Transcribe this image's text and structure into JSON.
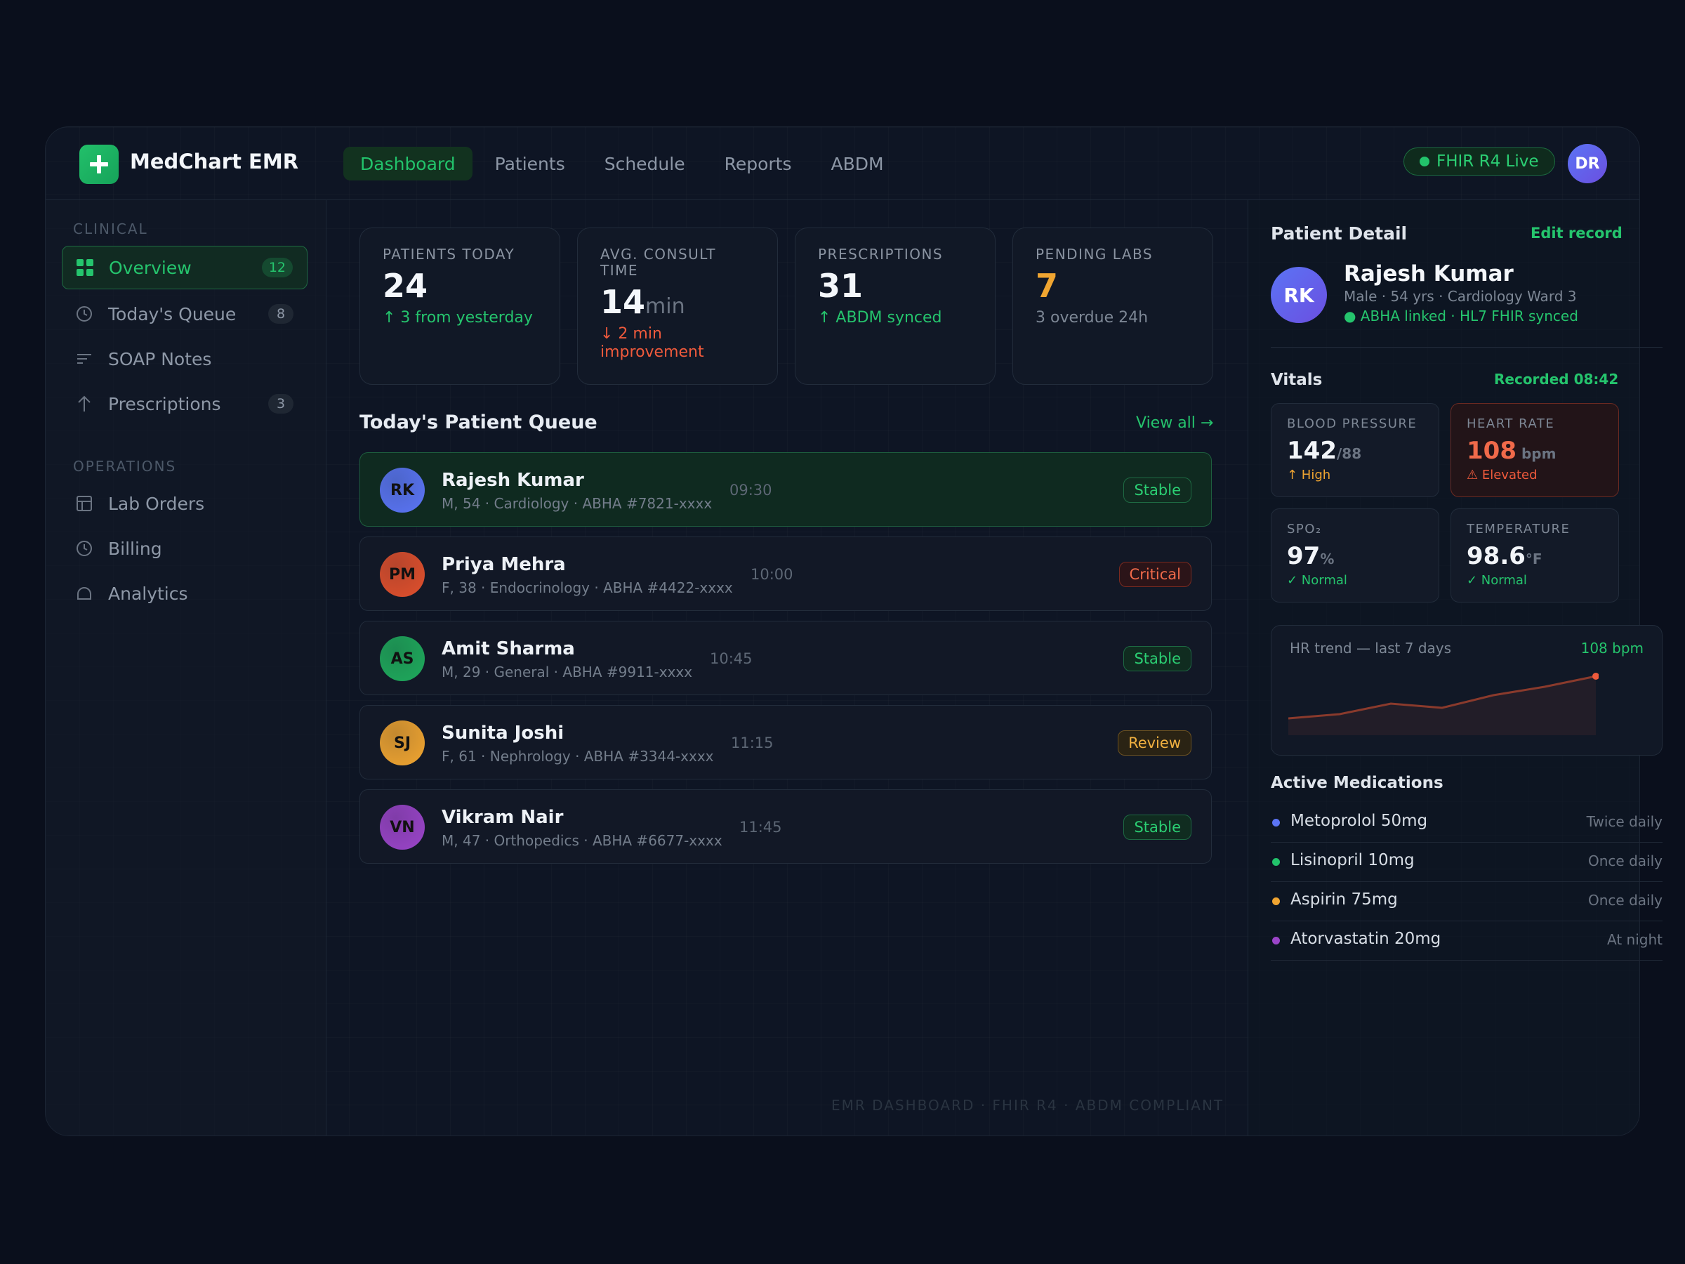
{
  "app": {
    "title": "MedChart EMR"
  },
  "nav": {
    "items": [
      "Dashboard",
      "Patients",
      "Schedule",
      "Reports",
      "ABDM"
    ],
    "active": "Dashboard"
  },
  "header": {
    "fhir_status": "FHIR R4 Live",
    "user_initials": "DR"
  },
  "sidebar": {
    "clinical_label": "CLINICAL",
    "clinical_items": [
      {
        "label": "Overview",
        "count": "12",
        "icon": "grid-icon"
      },
      {
        "label": "Today's Queue",
        "count": "8",
        "icon": "clock-icon"
      },
      {
        "label": "SOAP Notes",
        "count": "",
        "icon": "lines-icon"
      },
      {
        "label": "Prescriptions",
        "count": "3",
        "icon": "arrow-up-icon"
      }
    ],
    "operations_label": "OPERATIONS",
    "operations_items": [
      {
        "label": "Lab Orders",
        "icon": "table-icon"
      },
      {
        "label": "Billing",
        "icon": "clock-icon"
      },
      {
        "label": "Analytics",
        "icon": "bell-icon"
      }
    ]
  },
  "stats": [
    {
      "label": "PATIENTS TODAY",
      "value": "24",
      "unit": "",
      "delta": "↑ 3 from yesterday",
      "delta_color": "#25c46d",
      "value_color": "#f4f7fb"
    },
    {
      "label": "AVG. CONSULT TIME",
      "value": "14",
      "unit": "min",
      "delta": "↓ 2 min improvement",
      "delta_color": "#ef5a3c",
      "value_color": "#f4f7fb"
    },
    {
      "label": "PRESCRIPTIONS",
      "value": "31",
      "unit": "",
      "delta": "↑ ABDM synced",
      "delta_color": "#25c46d",
      "value_color": "#f4f7fb"
    },
    {
      "label": "PENDING LABS",
      "value": "7",
      "unit": "",
      "delta": "3 overdue 24h",
      "delta_color": "#7d8795",
      "value_color": "#f0a531"
    }
  ],
  "queue": {
    "title": "Today's Patient Queue",
    "view_all": "View all →",
    "rows": [
      {
        "initials": "RK",
        "name": "Rajesh Kumar",
        "meta": "M, 54 · Cardiology · ABHA #7821-xxxx",
        "time": "09:30",
        "status": "Stable",
        "avatar_color": "#5b74f5"
      },
      {
        "initials": "PM",
        "name": "Priya Mehra",
        "meta": "F, 38 · Endocrinology · ABHA #4422-xxxx",
        "time": "10:00",
        "status": "Critical",
        "avatar_color": "#e0502d"
      },
      {
        "initials": "AS",
        "name": "Amit Sharma",
        "meta": "M, 29 · General · ABHA #9911-xxxx",
        "time": "10:45",
        "status": "Stable",
        "avatar_color": "#1faa5c"
      },
      {
        "initials": "SJ",
        "name": "Sunita Joshi",
        "meta": "F, 61 · Nephrology · ABHA #3344-xxxx",
        "time": "11:15",
        "status": "Review",
        "avatar_color": "#f0a531"
      },
      {
        "initials": "VN",
        "name": "Vikram Nair",
        "meta": "M, 47 · Orthopedics · ABHA #6677-xxxx",
        "time": "11:45",
        "status": "Stable",
        "avatar_color": "#9b45c9"
      }
    ]
  },
  "footer": "EMR DASHBOARD · FHIR R4 · ABDM COMPLIANT",
  "detail": {
    "title": "Patient Detail",
    "edit": "Edit record",
    "initials": "RK",
    "name": "Rajesh Kumar",
    "info": "Male · 54 yrs · Cardiology Ward 3",
    "sync": "● ABHA linked · HL7 FHIR synced",
    "vitals_title": "Vitals",
    "recorded": "Recorded 08:42",
    "vitals": [
      {
        "label": "BLOOD PRESSURE",
        "value": "142",
        "unit": "/88",
        "status": "↑ High",
        "status_color": "#f0a531",
        "alert": false
      },
      {
        "label": "HEART RATE",
        "value": "108",
        "unit": " bpm",
        "status": "⚠ Elevated",
        "status_color": "#ef5a3c",
        "alert": true
      },
      {
        "label": "SPO₂",
        "value": "97",
        "unit": "%",
        "status": "✓ Normal",
        "status_color": "#25c46d",
        "alert": false
      },
      {
        "label": "TEMPERATURE",
        "value": "98.6",
        "unit": "°F",
        "status": "✓ Normal",
        "status_color": "#25c46d",
        "alert": false
      }
    ],
    "trend": {
      "label": "HR trend — last 7 days",
      "value": "108 bpm",
      "points": [
        88,
        90,
        95,
        93,
        99,
        103,
        108
      ],
      "y_range": [
        80,
        110
      ]
    },
    "meds_title": "Active Medications",
    "meds": [
      {
        "name": "Metoprolol 50mg",
        "freq": "Twice daily",
        "color": "#5b74f5"
      },
      {
        "name": "Lisinopril 10mg",
        "freq": "Once daily",
        "color": "#22c36b"
      },
      {
        "name": "Aspirin 75mg",
        "freq": "Once daily",
        "color": "#f0a531"
      },
      {
        "name": "Atorvastatin 20mg",
        "freq": "At night",
        "color": "#9b45c9"
      }
    ]
  }
}
